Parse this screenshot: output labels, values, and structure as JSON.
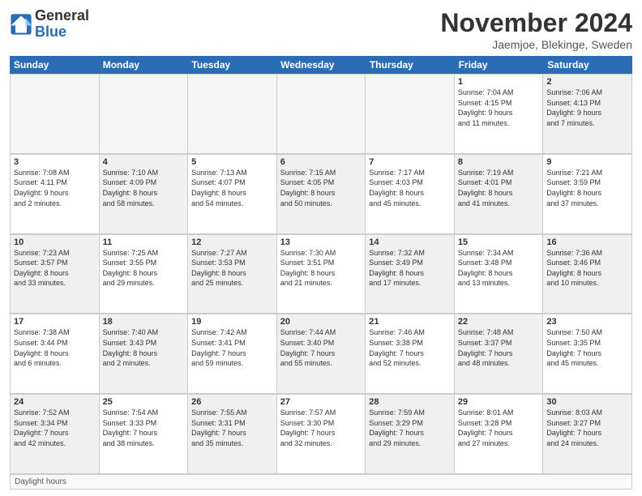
{
  "logo": {
    "general": "General",
    "blue": "Blue"
  },
  "title": "November 2024",
  "location": "Jaemjoe, Blekinge, Sweden",
  "days_header": [
    "Sunday",
    "Monday",
    "Tuesday",
    "Wednesday",
    "Thursday",
    "Friday",
    "Saturday"
  ],
  "daylight_label": "Daylight hours",
  "weeks": [
    {
      "cells": [
        {
          "day": "",
          "info": "",
          "empty": true
        },
        {
          "day": "",
          "info": "",
          "empty": true
        },
        {
          "day": "",
          "info": "",
          "empty": true
        },
        {
          "day": "",
          "info": "",
          "empty": true
        },
        {
          "day": "",
          "info": "",
          "empty": true
        },
        {
          "day": "1",
          "info": "Sunrise: 7:04 AM\nSunset: 4:15 PM\nDaylight: 9 hours\nand 11 minutes.",
          "empty": false,
          "shaded": false
        },
        {
          "day": "2",
          "info": "Sunrise: 7:06 AM\nSunset: 4:13 PM\nDaylight: 9 hours\nand 7 minutes.",
          "empty": false,
          "shaded": true
        }
      ]
    },
    {
      "cells": [
        {
          "day": "3",
          "info": "Sunrise: 7:08 AM\nSunset: 4:11 PM\nDaylight: 9 hours\nand 2 minutes.",
          "empty": false,
          "shaded": false
        },
        {
          "day": "4",
          "info": "Sunrise: 7:10 AM\nSunset: 4:09 PM\nDaylight: 8 hours\nand 58 minutes.",
          "empty": false,
          "shaded": true
        },
        {
          "day": "5",
          "info": "Sunrise: 7:13 AM\nSunset: 4:07 PM\nDaylight: 8 hours\nand 54 minutes.",
          "empty": false,
          "shaded": false
        },
        {
          "day": "6",
          "info": "Sunrise: 7:15 AM\nSunset: 4:05 PM\nDaylight: 8 hours\nand 50 minutes.",
          "empty": false,
          "shaded": true
        },
        {
          "day": "7",
          "info": "Sunrise: 7:17 AM\nSunset: 4:03 PM\nDaylight: 8 hours\nand 45 minutes.",
          "empty": false,
          "shaded": false
        },
        {
          "day": "8",
          "info": "Sunrise: 7:19 AM\nSunset: 4:01 PM\nDaylight: 8 hours\nand 41 minutes.",
          "empty": false,
          "shaded": true
        },
        {
          "day": "9",
          "info": "Sunrise: 7:21 AM\nSunset: 3:59 PM\nDaylight: 8 hours\nand 37 minutes.",
          "empty": false,
          "shaded": false
        }
      ]
    },
    {
      "cells": [
        {
          "day": "10",
          "info": "Sunrise: 7:23 AM\nSunset: 3:57 PM\nDaylight: 8 hours\nand 33 minutes.",
          "empty": false,
          "shaded": true
        },
        {
          "day": "11",
          "info": "Sunrise: 7:25 AM\nSunset: 3:55 PM\nDaylight: 8 hours\nand 29 minutes.",
          "empty": false,
          "shaded": false
        },
        {
          "day": "12",
          "info": "Sunrise: 7:27 AM\nSunset: 3:53 PM\nDaylight: 8 hours\nand 25 minutes.",
          "empty": false,
          "shaded": true
        },
        {
          "day": "13",
          "info": "Sunrise: 7:30 AM\nSunset: 3:51 PM\nDaylight: 8 hours\nand 21 minutes.",
          "empty": false,
          "shaded": false
        },
        {
          "day": "14",
          "info": "Sunrise: 7:32 AM\nSunset: 3:49 PM\nDaylight: 8 hours\nand 17 minutes.",
          "empty": false,
          "shaded": true
        },
        {
          "day": "15",
          "info": "Sunrise: 7:34 AM\nSunset: 3:48 PM\nDaylight: 8 hours\nand 13 minutes.",
          "empty": false,
          "shaded": false
        },
        {
          "day": "16",
          "info": "Sunrise: 7:36 AM\nSunset: 3:46 PM\nDaylight: 8 hours\nand 10 minutes.",
          "empty": false,
          "shaded": true
        }
      ]
    },
    {
      "cells": [
        {
          "day": "17",
          "info": "Sunrise: 7:38 AM\nSunset: 3:44 PM\nDaylight: 8 hours\nand 6 minutes.",
          "empty": false,
          "shaded": false
        },
        {
          "day": "18",
          "info": "Sunrise: 7:40 AM\nSunset: 3:43 PM\nDaylight: 8 hours\nand 2 minutes.",
          "empty": false,
          "shaded": true
        },
        {
          "day": "19",
          "info": "Sunrise: 7:42 AM\nSunset: 3:41 PM\nDaylight: 7 hours\nand 59 minutes.",
          "empty": false,
          "shaded": false
        },
        {
          "day": "20",
          "info": "Sunrise: 7:44 AM\nSunset: 3:40 PM\nDaylight: 7 hours\nand 55 minutes.",
          "empty": false,
          "shaded": true
        },
        {
          "day": "21",
          "info": "Sunrise: 7:46 AM\nSunset: 3:38 PM\nDaylight: 7 hours\nand 52 minutes.",
          "empty": false,
          "shaded": false
        },
        {
          "day": "22",
          "info": "Sunrise: 7:48 AM\nSunset: 3:37 PM\nDaylight: 7 hours\nand 48 minutes.",
          "empty": false,
          "shaded": true
        },
        {
          "day": "23",
          "info": "Sunrise: 7:50 AM\nSunset: 3:35 PM\nDaylight: 7 hours\nand 45 minutes.",
          "empty": false,
          "shaded": false
        }
      ]
    },
    {
      "cells": [
        {
          "day": "24",
          "info": "Sunrise: 7:52 AM\nSunset: 3:34 PM\nDaylight: 7 hours\nand 42 minutes.",
          "empty": false,
          "shaded": true
        },
        {
          "day": "25",
          "info": "Sunrise: 7:54 AM\nSunset: 3:33 PM\nDaylight: 7 hours\nand 38 minutes.",
          "empty": false,
          "shaded": false
        },
        {
          "day": "26",
          "info": "Sunrise: 7:55 AM\nSunset: 3:31 PM\nDaylight: 7 hours\nand 35 minutes.",
          "empty": false,
          "shaded": true
        },
        {
          "day": "27",
          "info": "Sunrise: 7:57 AM\nSunset: 3:30 PM\nDaylight: 7 hours\nand 32 minutes.",
          "empty": false,
          "shaded": false
        },
        {
          "day": "28",
          "info": "Sunrise: 7:59 AM\nSunset: 3:29 PM\nDaylight: 7 hours\nand 29 minutes.",
          "empty": false,
          "shaded": true
        },
        {
          "day": "29",
          "info": "Sunrise: 8:01 AM\nSunset: 3:28 PM\nDaylight: 7 hours\nand 27 minutes.",
          "empty": false,
          "shaded": false
        },
        {
          "day": "30",
          "info": "Sunrise: 8:03 AM\nSunset: 3:27 PM\nDaylight: 7 hours\nand 24 minutes.",
          "empty": false,
          "shaded": true
        }
      ]
    }
  ]
}
